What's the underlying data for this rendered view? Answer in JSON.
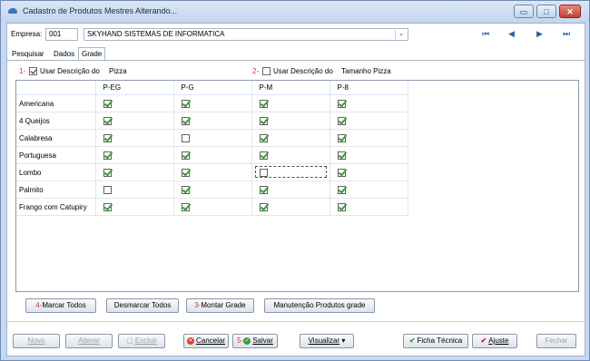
{
  "window": {
    "title": "Cadastro de Produtos Mestres Alterando...",
    "controls": [
      "minimize-icon",
      "maximize-icon",
      "close-icon"
    ]
  },
  "empresa": {
    "label": "Empresa:",
    "code": "001",
    "name": "SKYHAND SISTEMAS DE INFORMATICA"
  },
  "nav_icons": [
    "first-record-icon",
    "prev-record-icon",
    "next-record-icon",
    "last-record-icon"
  ],
  "tabs": [
    "Pesquisar",
    "Dados",
    "Grade"
  ],
  "active_tab": "Grade",
  "options": [
    {
      "marker": "1-",
      "label_a": "Usar Descrição do",
      "label_b": "Pizza",
      "checked": true
    },
    {
      "marker": "2-",
      "label_a": "Usar Descrição do",
      "label_b": "Tamanho Pizza",
      "checked": false
    }
  ],
  "grid": {
    "columns": [
      "P-EG",
      "P-G",
      "P-M",
      "P-8"
    ],
    "rows": [
      {
        "name": "Americana",
        "values": [
          true,
          true,
          true,
          true
        ]
      },
      {
        "name": "4 Queijos",
        "values": [
          true,
          true,
          true,
          true
        ]
      },
      {
        "name": "Calabresa",
        "values": [
          true,
          false,
          true,
          true
        ]
      },
      {
        "name": "Portuguesa",
        "values": [
          true,
          true,
          true,
          true
        ]
      },
      {
        "name": "Lombo",
        "values": [
          true,
          true,
          false,
          true
        ]
      },
      {
        "name": "Palmito",
        "values": [
          false,
          true,
          true,
          true
        ]
      },
      {
        "name": "Frango com Catupiry",
        "values": [
          true,
          true,
          true,
          true
        ]
      }
    ],
    "check_color": "#3d9a3d"
  },
  "grade_buttons": {
    "marcar_marker": "4-",
    "marcar": "Marcar Todos",
    "desmarcar": "Desmarcar Todos",
    "montar_marker": "3-",
    "montar": "Montar Grade",
    "manutencao": "Manutenção Produtos grade"
  },
  "footer": {
    "novo": "Novo",
    "alterar": "Alterar",
    "excluir": "Excluir",
    "cancelar": "Cancelar",
    "salvar_marker": "5-",
    "salvar": "Salvar",
    "visualizar": "Visualizar",
    "ficha": "Ficha Técnica",
    "ajuste": "Ajuste",
    "fechar": "Fechar"
  },
  "colors": {
    "accent_red": "#e03131",
    "title_blue": "#3f6fbf"
  }
}
